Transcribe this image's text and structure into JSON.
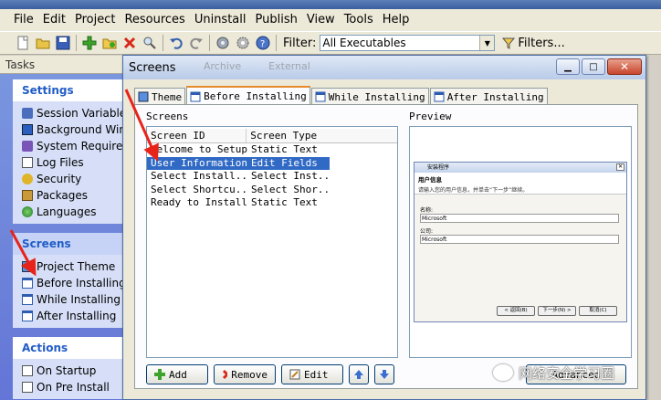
{
  "menu": [
    "File",
    "Edit",
    "Project",
    "Resources",
    "Uninstall",
    "Publish",
    "View",
    "Tools",
    "Help"
  ],
  "toolbar": {
    "icons": [
      "new-icon",
      "open-icon",
      "save-icon",
      "add-icon",
      "open-folder-icon",
      "remove-icon",
      "find-icon",
      "undo-icon",
      "redo-icon",
      "build-icon",
      "settings-icon",
      "help-icon"
    ],
    "filter_label": "Filter:",
    "filter_value": "All Executables",
    "filters_button": "Filters..."
  },
  "tasks": {
    "header": "Tasks",
    "settings": {
      "title": "Settings",
      "items": [
        "Session Variables",
        "Background Window",
        "System Requirements",
        "Log Files",
        "Security",
        "Packages",
        "Languages"
      ]
    },
    "screens": {
      "title": "Screens",
      "items": [
        "Project Theme",
        "Before Installing",
        "While Installing",
        "After Installing"
      ]
    },
    "actions": {
      "title": "Actions",
      "items": [
        "On Startup",
        "On Pre Install"
      ]
    }
  },
  "dialog": {
    "title": "Screens",
    "ghost_tabs": [
      "Archive",
      "External"
    ],
    "tabs": [
      "Theme",
      "Before Installing",
      "While Installing",
      "After Installing"
    ],
    "active_tab": 1,
    "screens_label": "Screens",
    "preview_label": "Preview",
    "columns": [
      "Screen ID",
      "Screen Type"
    ],
    "rows": [
      {
        "id": "Welcome to Setup",
        "type": "Static Text"
      },
      {
        "id": "User Information",
        "type": "Edit Fields"
      },
      {
        "id": "Select Install...",
        "type": "Select Inst..."
      },
      {
        "id": "Select Shortcu...",
        "type": "Select Shor..."
      },
      {
        "id": "Ready to Install",
        "type": "Static Text"
      }
    ],
    "selected_row": 1,
    "buttons": {
      "add": "Add",
      "remove": "Remove",
      "edit": "Edit",
      "advanced": "Advanced"
    },
    "preview": {
      "window_title": "安装程序",
      "heading": "用户信息",
      "subheading": "请输入您的用户信息，并单击“下一步”继续。",
      "field1_label": "名称:",
      "field1_value": "Microsoft",
      "field2_label": "公司:",
      "field2_value": "Microsoft",
      "back": "< 返回(B)",
      "next": "下一步(N) >",
      "cancel": "取消(C)"
    }
  },
  "watermark": "网络安全学习圈",
  "colors": {
    "selection": "#316ac5",
    "task_header": "#215dc6",
    "arrow": "#e8231a"
  }
}
